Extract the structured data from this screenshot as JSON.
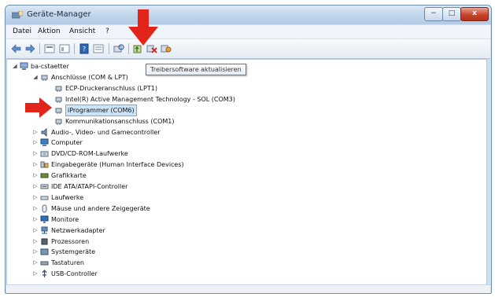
{
  "window": {
    "title": "Geräte-Manager",
    "min_label": "−",
    "max_label": "□",
    "close_label": "x"
  },
  "menu": [
    {
      "id": "datei",
      "label": "Datei"
    },
    {
      "id": "aktion",
      "label": "Aktion"
    },
    {
      "id": "ansicht",
      "label": "Ansicht"
    },
    {
      "id": "help",
      "label": "?"
    }
  ],
  "toolbar": {
    "tooltip": "Treibersoftware aktualisieren"
  },
  "tree": {
    "root": "ba-cstaetter",
    "nodes": [
      {
        "label": "Anschlüsse (COM & LPT)",
        "expanded": true,
        "icon": "port-icon"
      },
      {
        "label": "ECP-Druckeranschluss (LPT1)",
        "icon": "port-icon"
      },
      {
        "label": "Intel(R) Active Management Technology - SOL (COM3)",
        "icon": "port-icon"
      },
      {
        "label": "iProgrammer (COM6)",
        "icon": "port-icon",
        "selected": true
      },
      {
        "label": "Kommunikationsanschluss (COM1)",
        "icon": "port-icon"
      },
      {
        "label": "Audio-, Video- und Gamecontroller",
        "icon": "audio-icon"
      },
      {
        "label": "Computer",
        "icon": "computer-icon"
      },
      {
        "label": "DVD/CD-ROM-Laufwerke",
        "icon": "dvd-icon"
      },
      {
        "label": "Eingabegeräte (Human Interface Devices)",
        "icon": "hid-icon"
      },
      {
        "label": "Grafikkarte",
        "icon": "display-adapter-icon"
      },
      {
        "label": "IDE ATA/ATAPI-Controller",
        "icon": "ide-icon"
      },
      {
        "label": "Laufwerke",
        "icon": "drive-icon"
      },
      {
        "label": "Mäuse und andere Zeigegeräte",
        "icon": "mouse-icon"
      },
      {
        "label": "Monitore",
        "icon": "monitor-icon"
      },
      {
        "label": "Netzwerkadapter",
        "icon": "network-icon"
      },
      {
        "label": "Prozessoren",
        "icon": "cpu-icon"
      },
      {
        "label": "Systemgeräte",
        "icon": "system-icon"
      },
      {
        "label": "Tastaturen",
        "icon": "keyboard-icon"
      },
      {
        "label": "USB-Controller",
        "icon": "usb-icon"
      }
    ]
  },
  "colors": {
    "accent_arrow": "#e3241b",
    "selection": "#cce4f7"
  }
}
